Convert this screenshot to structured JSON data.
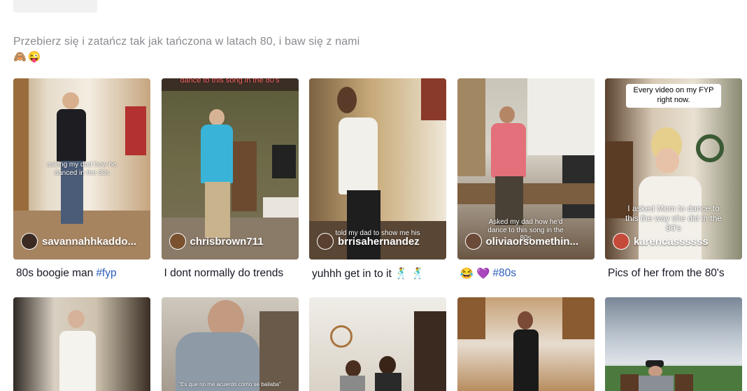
{
  "page": {
    "description": "Przebierz się i zatańcz tak jak tańczona w latach 80, i baw się z nami",
    "desc_emojis": [
      "🙈",
      "😜"
    ]
  },
  "videos_row1": [
    {
      "author": "savannahhkaddo...",
      "overlay": "asking my dad how he danced in the 80s",
      "caption": "80s boogie man",
      "caption_tag": "#fyp",
      "avatar_color": "#3a2a22"
    },
    {
      "author": "chrisbrown711",
      "overlay": "dance to this song in the 80's",
      "caption": "I dont normally do trends",
      "caption_tag": "",
      "avatar_color": "#7a5230"
    },
    {
      "author": "brrisahernandez",
      "overlay": "told my dad to show me his",
      "caption": "yuhhh get in to it 🕺 🕺",
      "caption_tag": "",
      "avatar_color": "#5a4030"
    },
    {
      "author": "oliviaorsomethin...",
      "overlay": "Asked my dad how he'd dance to this song in the 80s",
      "caption": "😂 💜",
      "caption_tag": "#80s",
      "avatar_color": "#6b4a3a"
    },
    {
      "author": "karencassssss",
      "overlay": "I asked Mom to dance to this the way she did in the 80's",
      "pill": "Every video on my FYP right now.",
      "caption": "Pics of her from the 80's",
      "caption_tag": "",
      "avatar_color": "#c44a3a"
    }
  ],
  "videos_row2": [
    {
      "overlay": ""
    },
    {
      "overlay": "\"Es que no me acuerdo cómo se bailaba\""
    },
    {
      "overlay": ""
    },
    {
      "overlay": ""
    },
    {
      "overlay": ""
    }
  ]
}
